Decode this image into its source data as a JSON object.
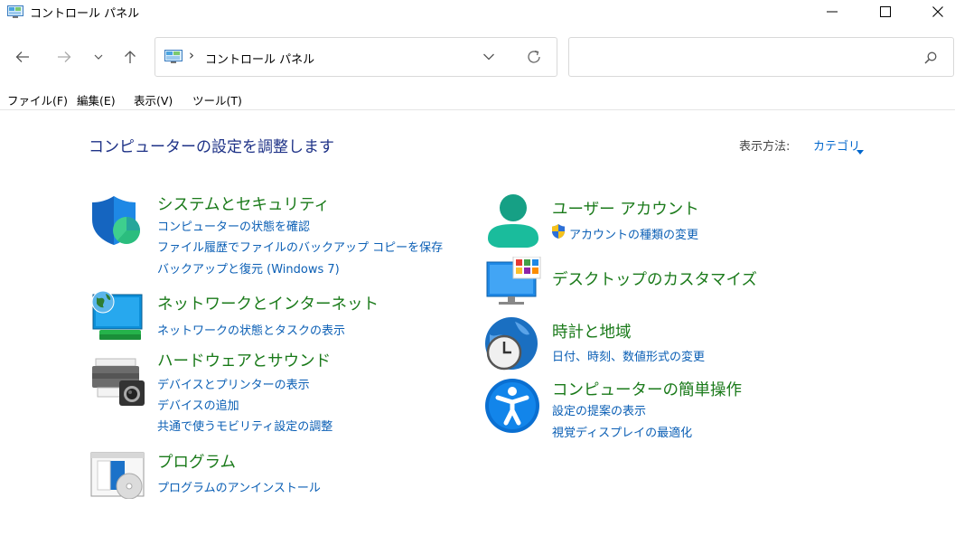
{
  "window": {
    "title": "コントロール パネル"
  },
  "nav": {
    "breadcrumb": "コントロール パネル",
    "breadcrumb_separator": "›",
    "search_placeholder": ""
  },
  "menu": {
    "items": [
      "ファイル(F)",
      "編集(E)",
      "表示(V)",
      "ツール(T)"
    ]
  },
  "main": {
    "heading": "コンピューターの設定を調整します",
    "view_by_label": "表示方法:",
    "view_by_value": "カテゴリ"
  },
  "categories": {
    "security": {
      "title": "システムとセキュリティ",
      "links": [
        "コンピューターの状態を確認",
        "ファイル履歴でファイルのバックアップ コピーを保存",
        "バックアップと復元 (Windows 7)"
      ]
    },
    "network": {
      "title": "ネットワークとインターネット",
      "links": [
        "ネットワークの状態とタスクの表示"
      ]
    },
    "hardware": {
      "title": "ハードウェアとサウンド",
      "links": [
        "デバイスとプリンターの表示",
        "デバイスの追加",
        "共通で使うモビリティ設定の調整"
      ]
    },
    "programs": {
      "title": "プログラム",
      "links": [
        "プログラムのアンインストール"
      ]
    },
    "user_accounts": {
      "title": "ユーザー アカウント",
      "links": [
        "アカウントの種類の変更"
      ]
    },
    "appearance": {
      "title": "デスクトップのカスタマイズ",
      "links": []
    },
    "clock": {
      "title": "時計と地域",
      "links": [
        "日付、時刻、数値形式の変更"
      ]
    },
    "ease": {
      "title": "コンピューターの簡単操作",
      "links": [
        "設定の提案の表示",
        "視覚ディスプレイの最適化"
      ]
    }
  },
  "colors": {
    "category_title": "#1a7a1a",
    "link": "#0b5fb5",
    "heading": "#1e3287"
  }
}
